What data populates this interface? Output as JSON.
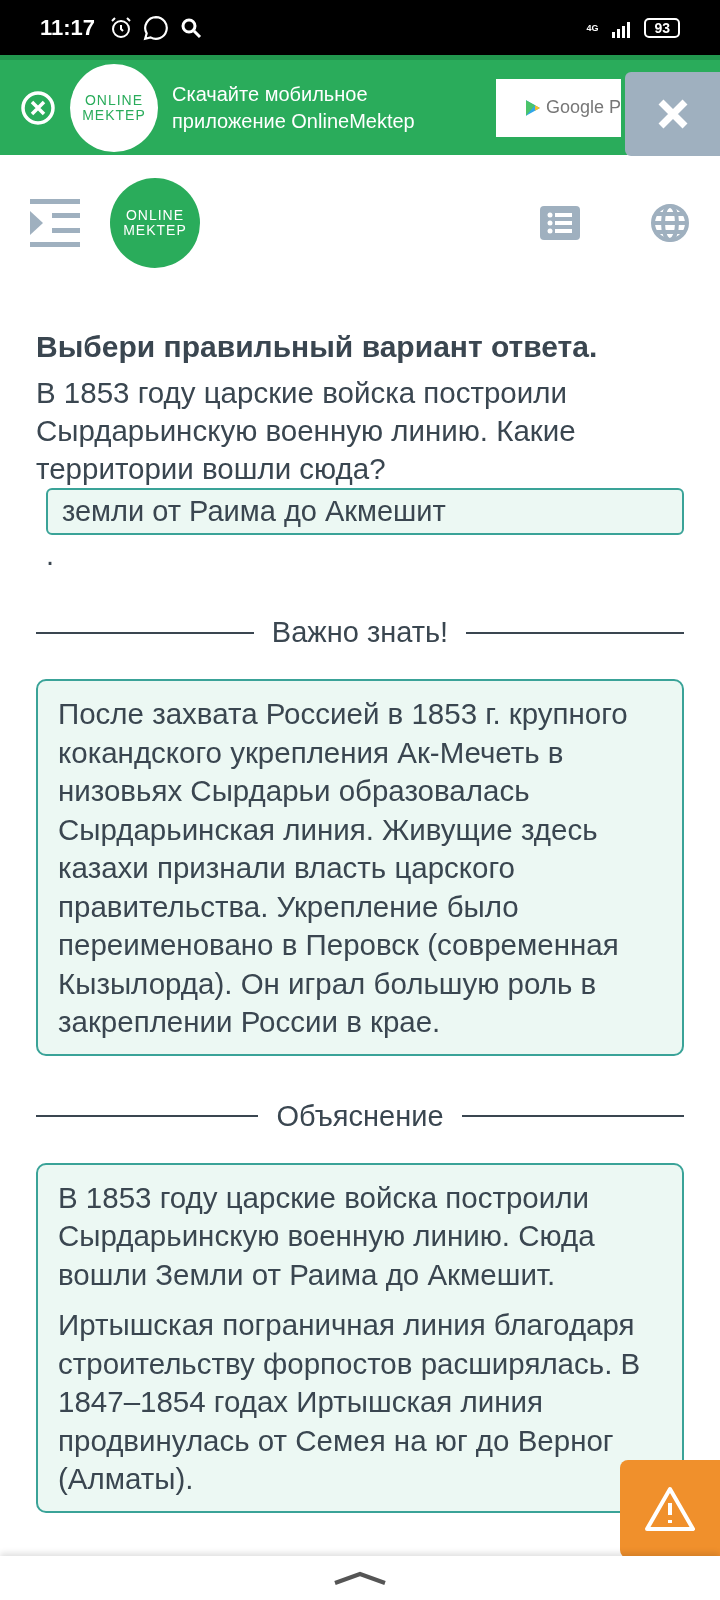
{
  "status_bar": {
    "time": "11:17",
    "network": "4G",
    "battery": "93"
  },
  "app_banner": {
    "logo_lines": [
      "ONLINE",
      "MEKTEP"
    ],
    "text": "Скачайте мобильное приложение OnlineMektep",
    "store_badge": "Google P"
  },
  "header": {
    "logo_lines": [
      "ONLINE",
      "MEKTEP"
    ]
  },
  "task": {
    "instruction": "Выбери правильный вариант ответа.",
    "question": "В 1853 году царские войска построили Сырдарьинскую военную линию. Какие территории вошли сюда?",
    "answer": "земли от Раима до Акмешит",
    "trailing": "."
  },
  "sections": [
    {
      "title": "Важно знать!",
      "paragraphs": [
        "После захвата Россией в 1853 г. крупного кокандского укрепления Ак-Мечеть в низовьях Сырдарьи образовалась Сырдарьинская линия. Живущие здесь казахи признали власть царского правительства. Укрепление было переименовано в Перовск (современная Кызылорда). Он играл большую роль в закреплении России в крае."
      ]
    },
    {
      "title": "Объяснение",
      "paragraphs": [
        "В 1853 году царские войска построили Сырдарьинскую военную линию. Сюда вошли Земли от Раима до Акмешит.",
        "Иртышская пограничная линия благодаря строительству форпостов расширялась. В 1847–1854 годах Иртышская линия продвинулась от Семея на юг до Верног (Алматы)."
      ]
    }
  ]
}
